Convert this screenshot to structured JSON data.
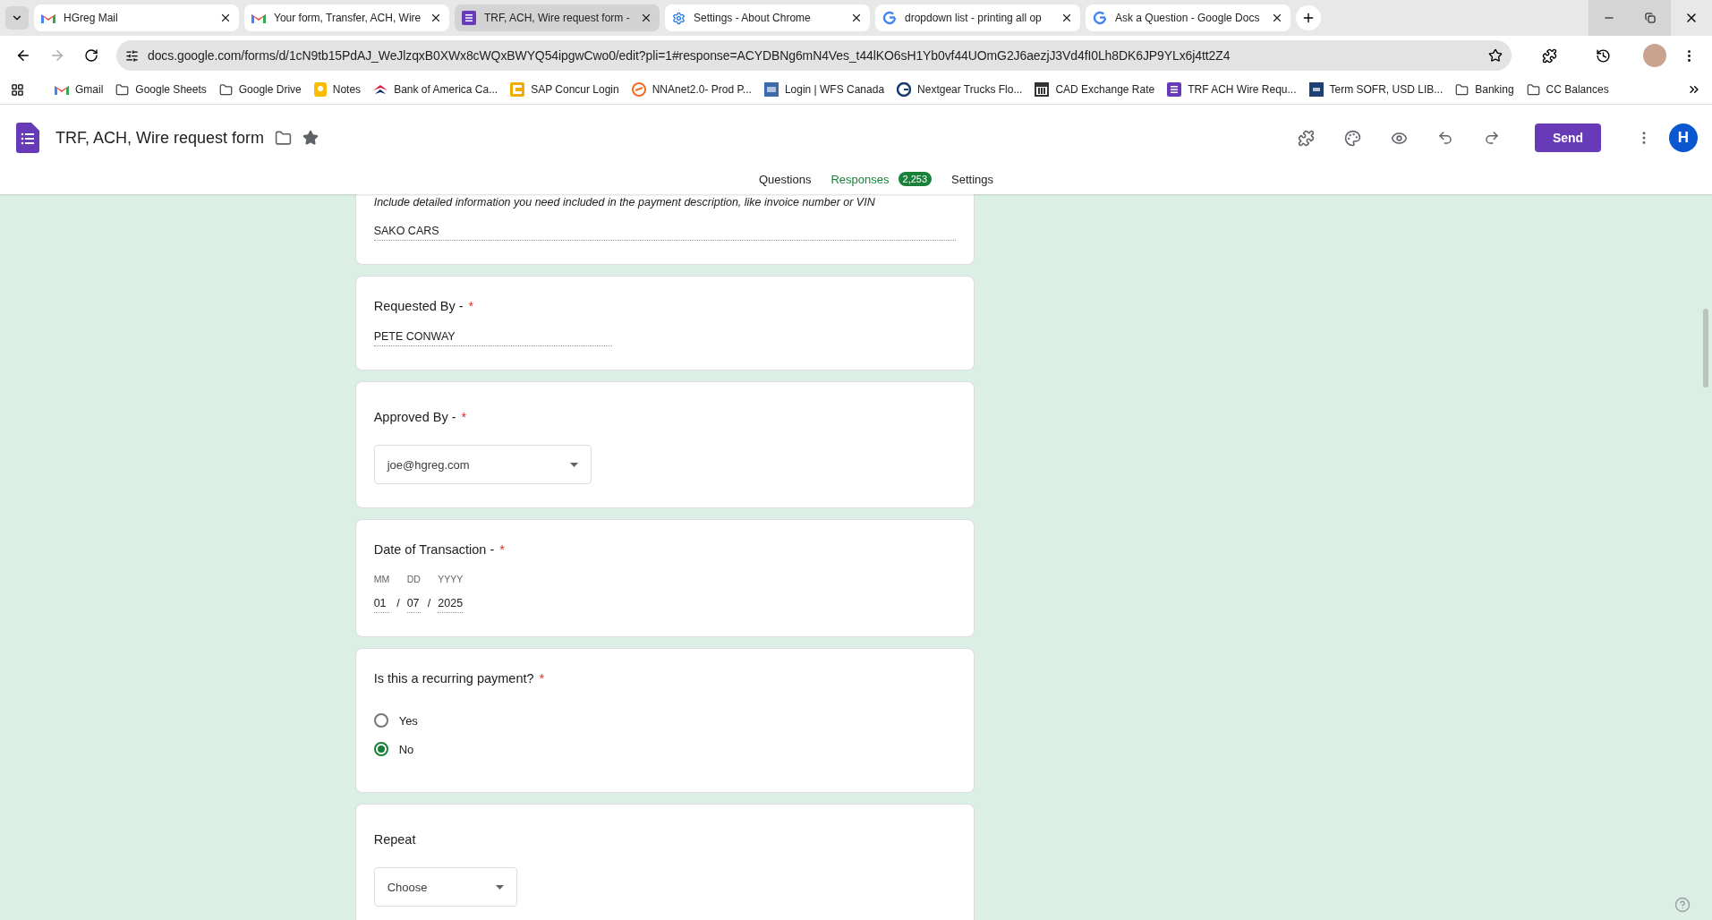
{
  "browser": {
    "tabs": [
      {
        "title": "HGreg Mail",
        "selected": false
      },
      {
        "title": "Your form, Transfer, ACH, Wire",
        "selected": false
      },
      {
        "title": "TRF, ACH, Wire request form -",
        "selected": true
      },
      {
        "title": "Settings - About Chrome",
        "selected": false
      },
      {
        "title": "dropdown list - printing all op",
        "selected": false
      },
      {
        "title": "Ask a Question - Google Docs",
        "selected": false
      }
    ],
    "address": "docs.google.com/forms/d/1cN9tb15PdAJ_WeJlzqxB0XWx8cWQxBWYQ54ipgwCwo0/edit?pli=1#response=ACYDBNg6mN4Ves_t44lKO6sH1Yb0vf44UOmG2J6aezjJ3Vd4fI0Lh8DK6JP9YLx6j4tt2Z4",
    "bookmarks": [
      "Gmail",
      "Google Sheets",
      "Google Drive",
      "Notes",
      "Bank of America Ca...",
      "SAP Concur Login",
      "NNAnet2.0- Prod P...",
      "Login | WFS Canada",
      "Nextgear Trucks Flo...",
      "CAD Exchange Rate",
      "TRF ACH Wire Requ...",
      "Term SOFR, USD LIB...",
      "Banking",
      "CC Balances"
    ]
  },
  "form": {
    "title": "TRF, ACH, Wire request form",
    "send": "Send",
    "avatar": "H",
    "nav": [
      {
        "label": "Questions",
        "selected": false
      },
      {
        "label": "Responses",
        "selected": true,
        "badge": "2,253"
      },
      {
        "label": "Settings",
        "selected": false
      }
    ],
    "cards": [
      {
        "kind": "text",
        "description": "Include detailed information you need included in the payment description, like invoice number or VIN",
        "value": "SAKO CARS"
      },
      {
        "kind": "text",
        "question": "Requested By  -",
        "required_mark": "*",
        "value": "PETE CONWAY"
      },
      {
        "kind": "dropdown",
        "question": "Approved By  -",
        "required_mark": "*",
        "value": "joe@hgreg.com"
      },
      {
        "kind": "date",
        "question": "Date of Transaction  -",
        "required_mark": "*",
        "separator": "/",
        "parts": [
          {
            "label": "MM",
            "value": "01"
          },
          {
            "label": "DD",
            "value": "07"
          },
          {
            "label": "YYYY",
            "value": "2025"
          }
        ]
      },
      {
        "kind": "radio",
        "question": "Is this a recurring payment?",
        "required_mark": "*",
        "options": [
          {
            "label": "Yes",
            "selected": false
          },
          {
            "label": "No",
            "selected": true
          }
        ]
      },
      {
        "kind": "dropdown",
        "question": "Repeat",
        "value": "Choose"
      }
    ]
  }
}
